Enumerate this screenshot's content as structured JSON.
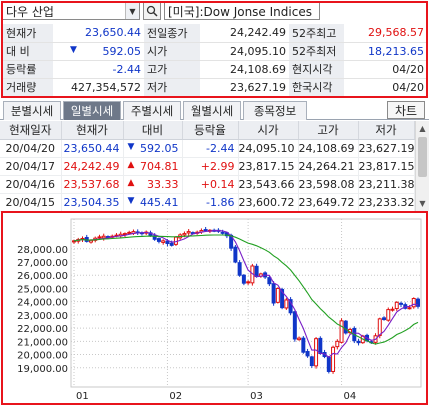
{
  "search": {
    "stock_name": "다우 산업",
    "market_code": "[미국]:Dow Jonse Indices"
  },
  "quote": {
    "rows": [
      [
        "현재가",
        "23,650.44",
        "전일종가",
        "24,242.49",
        "52주최고",
        "29,568.57"
      ],
      [
        "대 비",
        "592.05",
        "시가",
        "24,095.10",
        "52주최저",
        "18,213.65"
      ],
      [
        "등락률",
        "-2.44",
        "고가",
        "24,108.69",
        "현지시각",
        "04/20"
      ],
      [
        "거래량",
        "427,354,572",
        "저가",
        "23,627.19",
        "한국시각",
        "04/20"
      ]
    ]
  },
  "tabs": [
    "분별시세",
    "일별시세",
    "주별시세",
    "월별시세",
    "종목정보"
  ],
  "active_tab": "일별시세",
  "chart_button": "차트",
  "daily": {
    "headers": [
      "현재일자",
      "현재가",
      "대비",
      "등락율",
      "시가",
      "고가",
      "저가"
    ],
    "rows": [
      {
        "date": "20/04/20",
        "price": "23,650.44",
        "dir": "▼",
        "change": "592.05",
        "rate": "-2.44",
        "open": "24,095.10",
        "high": "24,108.69",
        "low": "23,627.19",
        "color": "#1036c8"
      },
      {
        "date": "20/04/17",
        "price": "24,242.49",
        "dir": "▲",
        "change": "704.81",
        "rate": "+2.99",
        "open": "23,817.15",
        "high": "24,264.21",
        "low": "23,817.15",
        "color": "#e01010"
      },
      {
        "date": "20/04/16",
        "price": "23,537.68",
        "dir": "▲",
        "change": "33.33",
        "rate": "+0.14",
        "open": "23,543.66",
        "high": "23,598.08",
        "low": "23,211.38",
        "color": "#e01010"
      },
      {
        "date": "20/04/15",
        "price": "23,504.35",
        "dir": "▼",
        "change": "445.41",
        "rate": "-1.86",
        "open": "23,600.72",
        "high": "23,649.72",
        "low": "23,233.32",
        "color": "#1036c8"
      }
    ]
  },
  "chart_data": {
    "type": "candlestick",
    "y_ticks": [
      "28,000.00",
      "27,000.00",
      "26,000.00",
      "25,000.00",
      "24,000.00",
      "23,000.00",
      "22,000.00",
      "21,000.00",
      "20,000.00",
      "19,000.00"
    ],
    "ylim": [
      18000,
      29800
    ],
    "x_ticks": [
      "01",
      "02",
      "03",
      "04"
    ],
    "x_tick_index": [
      0,
      22,
      41,
      63
    ],
    "series": [
      {
        "values": [
          28600,
          28700,
          28780,
          28560,
          28640,
          28800,
          28900,
          28950,
          28880,
          28950,
          29030,
          29100,
          29150,
          29240,
          29300,
          29196,
          29180,
          29260,
          28990,
          28720,
          28560,
          28600,
          28400,
          28260,
          28880,
          29050,
          29150,
          29300,
          29200,
          29250,
          29380,
          29450,
          29400,
          29350,
          29320,
          29240,
          28990,
          28050,
          27000,
          26000,
          25400,
          25500,
          26700,
          25900,
          26100,
          25870,
          25360,
          23900,
          25000,
          23550,
          24130,
          23160,
          21180,
          21240,
          20180,
          19900,
          19170,
          21200,
          20080,
          19850,
          18720,
          20550,
          21000,
          22550,
          21636,
          21900,
          21050,
          20900,
          21400,
          21050,
          20950,
          21420,
          22700,
          22650,
          23400,
          23430,
          23950,
          23800,
          23500,
          23540,
          24240,
          23650
        ]
      }
    ]
  },
  "colors": {
    "up": "#e01010",
    "down": "#1036c8",
    "ma_short": "#7a1fc8",
    "ma_long": "#22a022",
    "highlight": "#e8141c"
  }
}
